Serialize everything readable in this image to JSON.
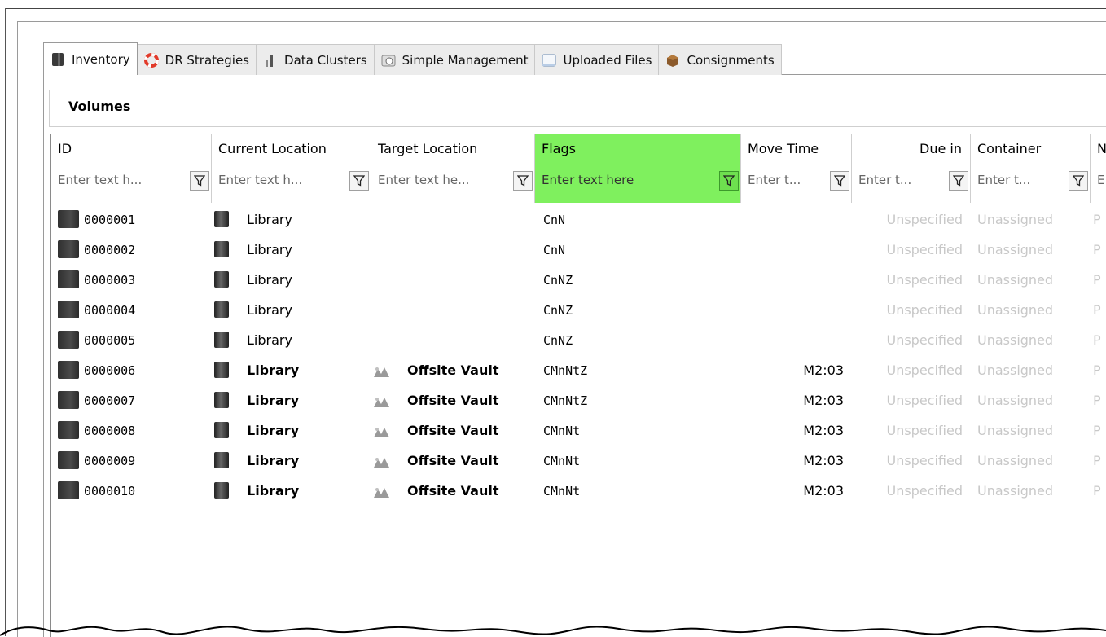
{
  "tabs": [
    {
      "label": "Inventory",
      "icon": "volume-icon",
      "active": true
    },
    {
      "label": "DR Strategies",
      "icon": "lifebuoy-icon",
      "active": false
    },
    {
      "label": "Data Clusters",
      "icon": "chart-bars-icon",
      "active": false
    },
    {
      "label": "Simple Management",
      "icon": "dial-icon",
      "active": false
    },
    {
      "label": "Uploaded Files",
      "icon": "window-icon",
      "active": false
    },
    {
      "label": "Consignments",
      "icon": "box-icon",
      "active": false
    }
  ],
  "section": {
    "title": "Volumes"
  },
  "columns": [
    {
      "title": "ID",
      "filter_placeholder": "Enter text h..."
    },
    {
      "title": "Current Location",
      "filter_placeholder": "Enter text h..."
    },
    {
      "title": "Target Location",
      "filter_placeholder": "Enter text he..."
    },
    {
      "title": "Flags",
      "filter_placeholder": "Enter text here"
    },
    {
      "title": "Move Time",
      "filter_placeholder": "Enter t..."
    },
    {
      "title": "Due in",
      "filter_placeholder": "Enter t..."
    },
    {
      "title": "Container",
      "filter_placeholder": "Enter t..."
    },
    {
      "title": "N",
      "filter_placeholder": "E"
    }
  ],
  "highlight_color": "#7ff05e",
  "rows": [
    {
      "id": "0000001",
      "current": "Library",
      "target": "",
      "flags": "CnN",
      "move_time": "",
      "due_in": "Unspecified",
      "container": "Unassigned",
      "n": "P",
      "bold": false
    },
    {
      "id": "0000002",
      "current": "Library",
      "target": "",
      "flags": "CnN",
      "move_time": "",
      "due_in": "Unspecified",
      "container": "Unassigned",
      "n": "P",
      "bold": false
    },
    {
      "id": "0000003",
      "current": "Library",
      "target": "",
      "flags": "CnNZ",
      "move_time": "",
      "due_in": "Unspecified",
      "container": "Unassigned",
      "n": "P",
      "bold": false
    },
    {
      "id": "0000004",
      "current": "Library",
      "target": "",
      "flags": "CnNZ",
      "move_time": "",
      "due_in": "Unspecified",
      "container": "Unassigned",
      "n": "P",
      "bold": false
    },
    {
      "id": "0000005",
      "current": "Library",
      "target": "",
      "flags": "CnNZ",
      "move_time": "",
      "due_in": "Unspecified",
      "container": "Unassigned",
      "n": "P",
      "bold": false
    },
    {
      "id": "0000006",
      "current": "Library",
      "target": "Offsite Vault",
      "flags": "CMnNtZ",
      "move_time": "M2:03",
      "due_in": "Unspecified",
      "container": "Unassigned",
      "n": "P",
      "bold": true
    },
    {
      "id": "0000007",
      "current": "Library",
      "target": "Offsite Vault",
      "flags": "CMnNtZ",
      "move_time": "M2:03",
      "due_in": "Unspecified",
      "container": "Unassigned",
      "n": "P",
      "bold": true
    },
    {
      "id": "0000008",
      "current": "Library",
      "target": "Offsite Vault",
      "flags": "CMnNt",
      "move_time": "M2:03",
      "due_in": "Unspecified",
      "container": "Unassigned",
      "n": "P",
      "bold": true
    },
    {
      "id": "0000009",
      "current": "Library",
      "target": "Offsite Vault",
      "flags": "CMnNt",
      "move_time": "M2:03",
      "due_in": "Unspecified",
      "container": "Unassigned",
      "n": "P",
      "bold": true
    },
    {
      "id": "0000010",
      "current": "Library",
      "target": "Offsite Vault",
      "flags": "CMnNt",
      "move_time": "M2:03",
      "due_in": "Unspecified",
      "container": "Unassigned",
      "n": "P",
      "bold": true
    }
  ]
}
